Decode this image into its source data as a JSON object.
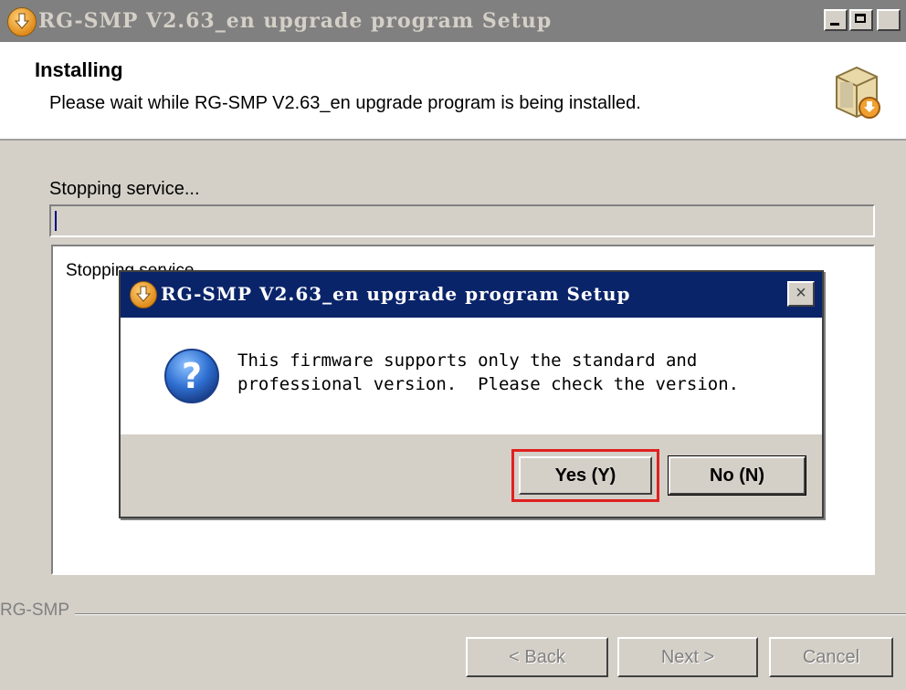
{
  "window": {
    "title": "RG-SMP V2.63_en upgrade program Setup",
    "header_title": "Installing",
    "header_subtitle": "Please wait while RG-SMP V2.63_en upgrade program is being installed.",
    "status_text": "Stopping service...",
    "progress_fraction": 0.0,
    "log_lines": [
      "Stopping service..."
    ],
    "group_label": "RG-SMP",
    "buttons": {
      "back": "< Back",
      "next": "Next >",
      "cancel": "Cancel"
    }
  },
  "dialog": {
    "title": "RG-SMP V2.63_en upgrade program Setup",
    "close_glyph": "×",
    "message_line1": "This firmware supports only the standard and",
    "message_line2": "professional version.  Please check the version.",
    "yes_label": "Yes (Y)",
    "no_label": "No (N)",
    "highlight_color": "#e02020"
  },
  "icons": {
    "app": "installer-download-icon",
    "header": "package-box-icon",
    "question": "question-icon"
  }
}
